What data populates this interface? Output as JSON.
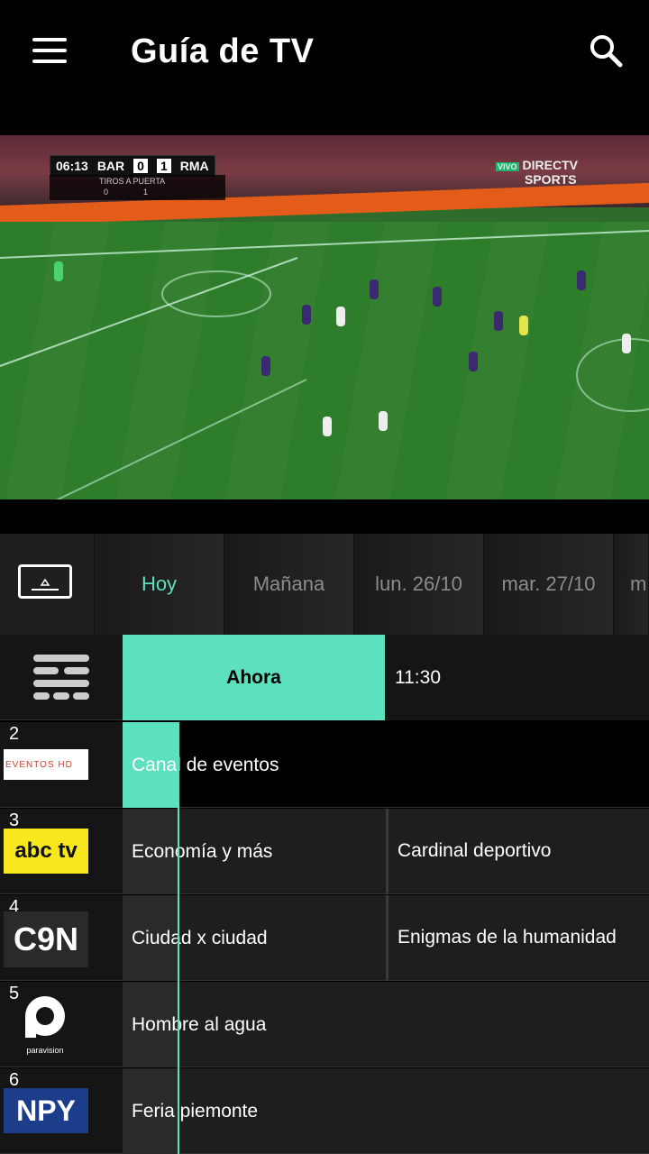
{
  "header": {
    "title": "Guía de TV",
    "menu_icon": "hamburger-menu-icon",
    "search_icon": "search-icon"
  },
  "player": {
    "clock": "06:13",
    "home": "BAR",
    "home_score": "0",
    "away_score": "1",
    "away": "RMA",
    "stat_label": "TIROS A PUERTA",
    "home_stat": "0",
    "away_stat": "1",
    "live_badge": "VIVO",
    "broadcaster_line1": "DIRECTV",
    "broadcaster_line2": "SPORTS"
  },
  "day_tabs": [
    {
      "label": "Hoy",
      "active": true
    },
    {
      "label": "Mañana",
      "active": false
    },
    {
      "label": "lun. 26/10",
      "active": false
    },
    {
      "label": "mar. 27/10",
      "active": false
    },
    {
      "label": "m",
      "active": false
    }
  ],
  "timeline": {
    "now_label": "Ahora",
    "next_label": "11:30"
  },
  "channels": [
    {
      "number": "2",
      "logo": "EVENTOS HD",
      "programs": [
        "Canal de eventos"
      ]
    },
    {
      "number": "3",
      "logo": "abc tv",
      "programs": [
        "Economía y más",
        "Cardinal deportivo"
      ]
    },
    {
      "number": "4",
      "logo": "C9N",
      "programs": [
        "Ciudad x ciudad",
        "Enigmas de la humanidad"
      ]
    },
    {
      "number": "5",
      "logo": "paravision",
      "programs": [
        "Hombre al agua"
      ]
    },
    {
      "number": "6",
      "logo": "NPY",
      "programs": [
        "Feria piemonte"
      ]
    }
  ],
  "colors": {
    "accent": "#5de0bd",
    "background": "#000000",
    "cell": "#1e1e1e"
  }
}
